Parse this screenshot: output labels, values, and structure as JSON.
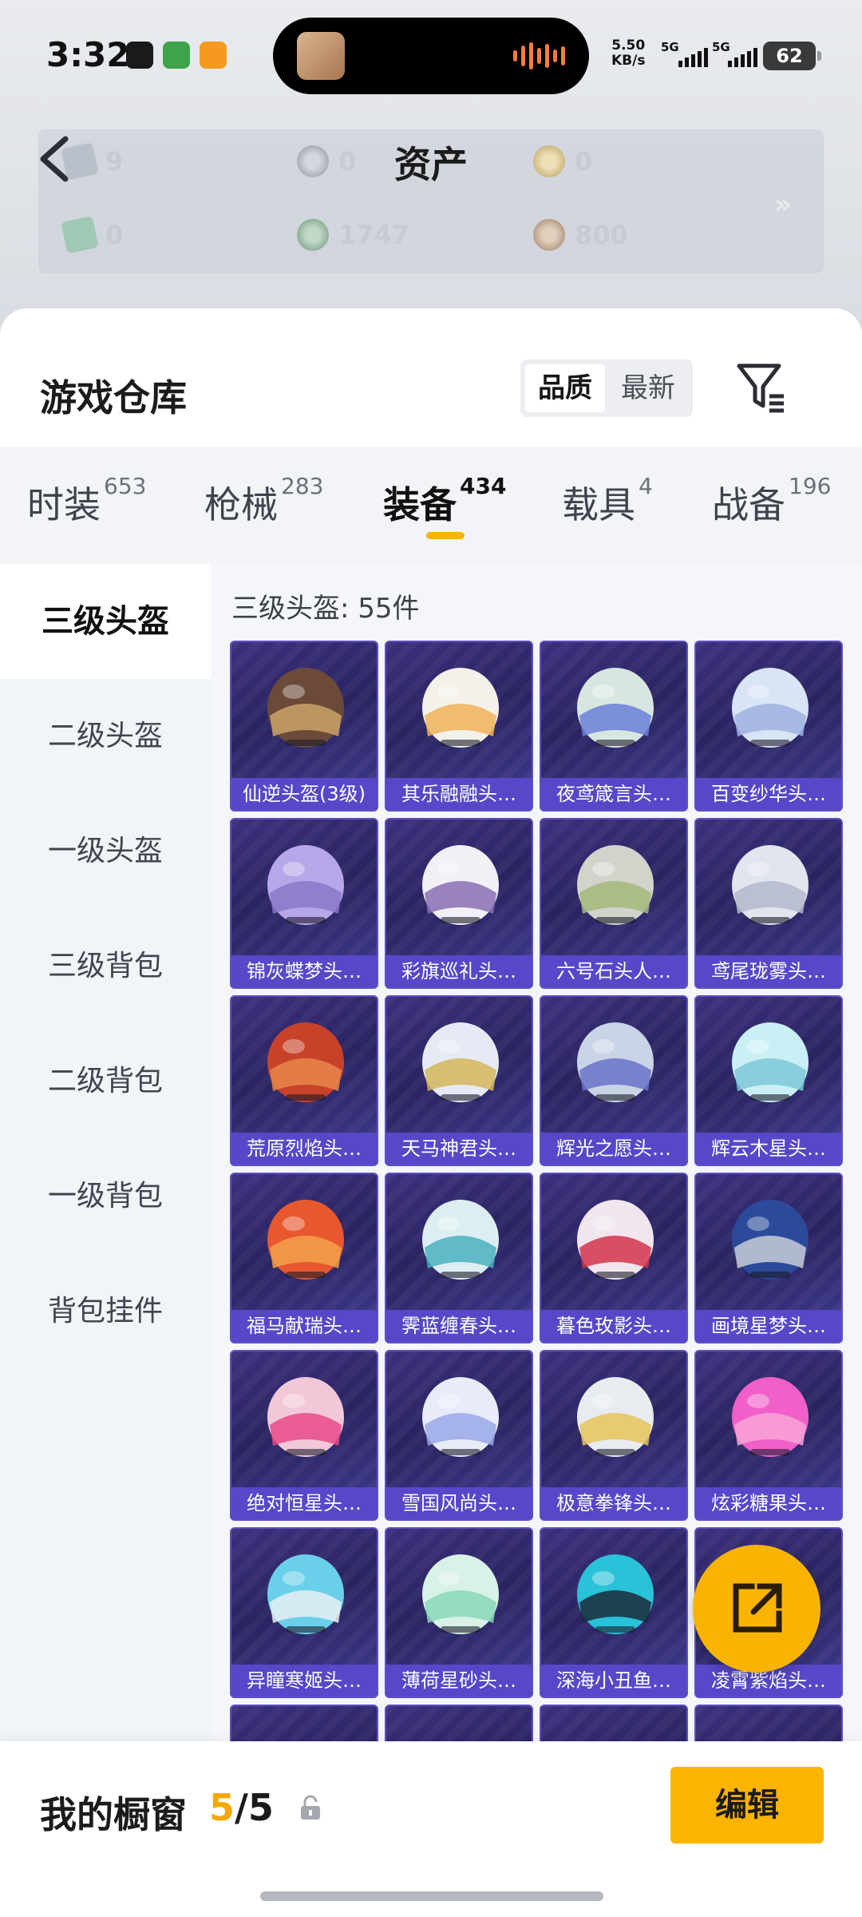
{
  "status_bar": {
    "time": "3:32",
    "net_speed_value": "5.50",
    "net_speed_unit": "KB/s",
    "sim1": "5G",
    "sim2": "5G",
    "battery": "62"
  },
  "assets": {
    "title": "资产",
    "items": [
      {
        "value": "9",
        "icon": "card-icon",
        "color": "#b9c0c9"
      },
      {
        "value": "0",
        "icon": "silver-coin-icon",
        "color": "#b7bcc4"
      },
      {
        "value": "0",
        "icon": "gold-coin-icon",
        "color": "#d8c89a"
      },
      {
        "value": "0",
        "icon": "green-card-icon",
        "color": "#9fc9b5"
      },
      {
        "value": "1747",
        "icon": "jade-coin-icon",
        "color": "#9fc0a8"
      },
      {
        "value": "800",
        "icon": "bronze-coin-icon",
        "color": "#c8b3a0"
      }
    ],
    "more": "»"
  },
  "warehouse": {
    "title": "游戏仓库",
    "sort_options": [
      "品质",
      "最新"
    ],
    "sort_active": "品质"
  },
  "tabs": [
    {
      "label": "时装",
      "count": "653"
    },
    {
      "label": "枪械",
      "count": "283"
    },
    {
      "label": "装备",
      "count": "434",
      "active": true
    },
    {
      "label": "载具",
      "count": "4"
    },
    {
      "label": "战备",
      "count": "196"
    }
  ],
  "categories": [
    "三级头盔",
    "二级头盔",
    "一级头盔",
    "三级背包",
    "二级背包",
    "一级背包",
    "背包挂件"
  ],
  "active_category": "三级头盔",
  "count_label": "三级头盔: 55件",
  "items": [
    {
      "name": "仙逆头盔(3级)",
      "c1": "#6b4a3a",
      "c2": "#c9a36a"
    },
    {
      "name": "其乐融融头…",
      "c1": "#f4f1ea",
      "c2": "#f0b35a"
    },
    {
      "name": "夜鸢箴言头…",
      "c1": "#d8e6e0",
      "c2": "#6b7fd8"
    },
    {
      "name": "百变纱华头…",
      "c1": "#d9e4f5",
      "c2": "#9fb3e0"
    },
    {
      "name": "锦灰蝶梦头…",
      "c1": "#b7a6e8",
      "c2": "#8a78c8"
    },
    {
      "name": "彩旗巡礼头…",
      "c1": "#f2f0f6",
      "c2": "#8a6fb4"
    },
    {
      "name": "六号石头人…",
      "c1": "#d2d4cc",
      "c2": "#a4b87a"
    },
    {
      "name": "鸢尾珑雾头…",
      "c1": "#e2e4ee",
      "c2": "#b4b8cc"
    },
    {
      "name": "荒原烈焰头…",
      "c1": "#c8422a",
      "c2": "#e8874a"
    },
    {
      "name": "天马神君头…",
      "c1": "#e6eaf5",
      "c2": "#d4b65a"
    },
    {
      "name": "辉光之愿头…",
      "c1": "#c9d4e6",
      "c2": "#6a72c8"
    },
    {
      "name": "辉云木星头…",
      "c1": "#c9f0f4",
      "c2": "#7fc8d8"
    },
    {
      "name": "福马献瑞头…",
      "c1": "#e8582e",
      "c2": "#f2a04a"
    },
    {
      "name": "霁蓝缠春头…",
      "c1": "#dceef2",
      "c2": "#4ab0c0"
    },
    {
      "name": "暮色玫影头…",
      "c1": "#f0e6ee",
      "c2": "#d4344a"
    },
    {
      "name": "画境星梦头…",
      "c1": "#2c4a9a",
      "c2": "#c8ccd8"
    },
    {
      "name": "绝对恒星头…",
      "c1": "#f2c8d8",
      "c2": "#e84a88"
    },
    {
      "name": "雪国风尚头…",
      "c1": "#e8ecf8",
      "c2": "#9aa8e8"
    },
    {
      "name": "极意拳锋头…",
      "c1": "#e8ecf0",
      "c2": "#e8c45a"
    },
    {
      "name": "炫彩糖果头…",
      "c1": "#f060c8",
      "c2": "#f8a4d8"
    },
    {
      "name": "异瞳寒姬头…",
      "c1": "#6ad0ea",
      "c2": "#e8eef4"
    },
    {
      "name": "薄荷星砂头…",
      "c1": "#d8f2e8",
      "c2": "#8ad8b8"
    },
    {
      "name": "深海小丑鱼…",
      "c1": "#2ac2d8",
      "c2": "#1a2a3a"
    },
    {
      "name": "凌霄紫焰头…",
      "c1": "#d6d8f0",
      "c2": "#8f7ad8"
    }
  ],
  "showcase": {
    "title": "我的橱窗",
    "current": "5",
    "separator": "/",
    "total": "5",
    "edit_label": "编辑"
  },
  "colors": {
    "accent": "#f5b500",
    "card_purple": "#5648c8"
  }
}
